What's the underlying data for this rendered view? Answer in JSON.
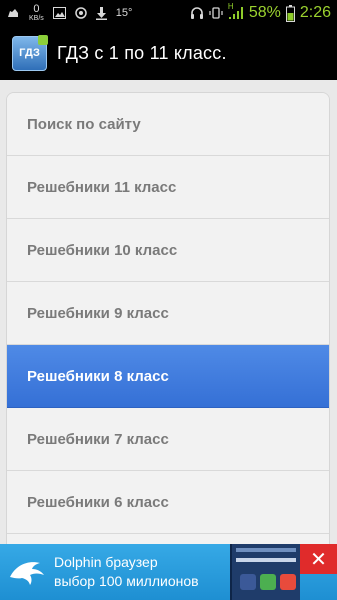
{
  "status_bar": {
    "network_speed_value": "0",
    "network_speed_unit": "KB/s",
    "temperature": "15°",
    "signal_type": "H",
    "battery_percent": "58%",
    "time": "2:26",
    "icons": [
      "cloud-icon",
      "image-icon",
      "record-icon",
      "download-icon",
      "headphones-icon",
      "vibrate-icon",
      "signal-icon",
      "battery-icon"
    ]
  },
  "action_bar": {
    "app_icon_text": "ГДЗ",
    "title": "ГДЗ с 1 по 11 класс."
  },
  "menu": {
    "items": [
      {
        "label": "Поиск по сайту"
      },
      {
        "label": "Решебники 11 класс"
      },
      {
        "label": "Решебники 10 класс"
      },
      {
        "label": "Решебники 9 класс"
      },
      {
        "label": "Решебники 8 класс"
      },
      {
        "label": "Решебники 7 класс"
      },
      {
        "label": "Решебники 6 класс"
      }
    ],
    "active_index": 4
  },
  "ad": {
    "line1": "Dolphin браузер",
    "line2": "выбор 100 миллионов",
    "close_icon": "close-icon"
  },
  "colors": {
    "active_item": "#3b76dc",
    "ad_background": "#2a9cdc",
    "status_accent": "#9bd22f"
  }
}
